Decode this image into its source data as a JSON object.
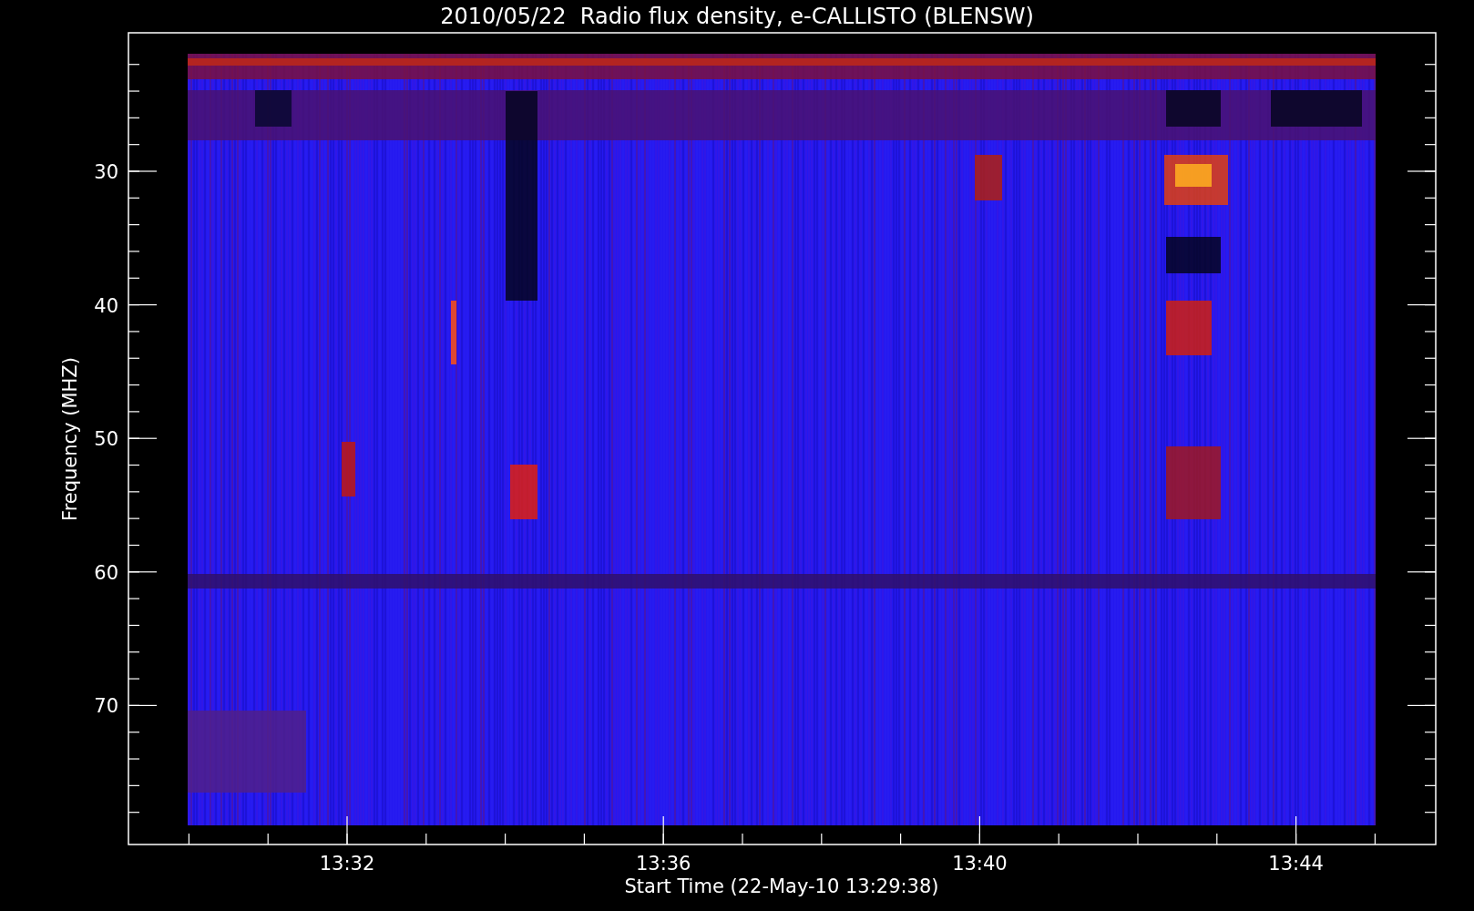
{
  "title": "2010/05/22  Radio flux density, e-CALLISTO (BLENSW)",
  "y_axis": {
    "label": "Frequency (MHZ)",
    "ticks": [
      "30",
      "40",
      "50",
      "60",
      "70"
    ]
  },
  "x_axis": {
    "label": "Start Time (22-May-10 13:29:38)",
    "ticks": [
      "13:32",
      "13:36",
      "13:40",
      "13:44"
    ]
  }
}
